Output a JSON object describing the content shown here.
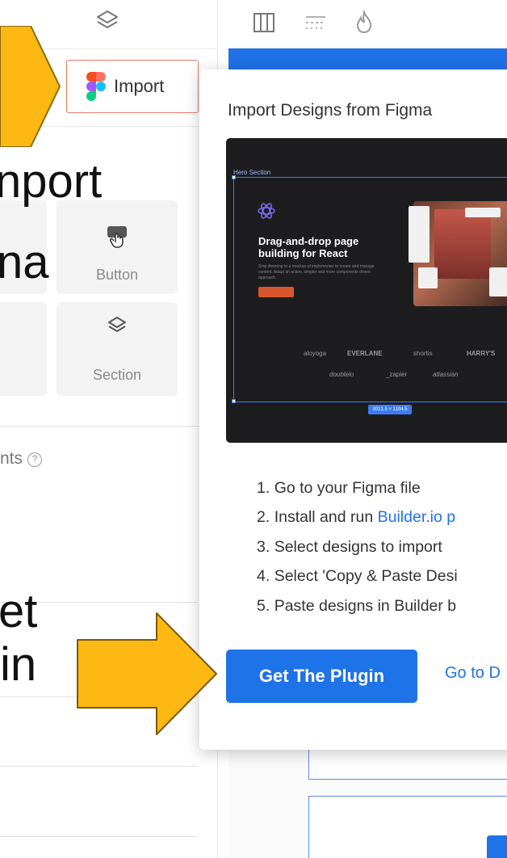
{
  "left_panel": {
    "import_label": "Import",
    "tiles": [
      {
        "label": "Button",
        "icon": "pointer-hand-icon"
      },
      {
        "label": "Section",
        "icon": "layers-icon"
      }
    ],
    "hint_text": "nts",
    "big_text_lines": [
      "nport",
      "na",
      "et",
      "in"
    ]
  },
  "popup": {
    "title": "Import Designs from Figma",
    "preview": {
      "section_tag": "Hero Section",
      "hero_title": "Drag-and-drop page building for React",
      "hero_sub": "Stop diverting to a mockup of implementer to create and manage content. Adapt an action, simpler and more components driven approach.",
      "brands": [
        "aloyoga",
        "EVERLANE",
        "shortis",
        "HARRY'S",
        "doubleio",
        "_zapier",
        "atlassian"
      ],
      "size_tag": "3021.5 × 1104.5"
    },
    "steps": [
      {
        "num": "1.",
        "text": "Go to your Figma file"
      },
      {
        "num": "2.",
        "text": "Install and run ",
        "link": "Builder.io p"
      },
      {
        "num": "3.",
        "text": "Select designs to import"
      },
      {
        "num": "4.",
        "text": "Select 'Copy & Paste Desi"
      },
      {
        "num": "5.",
        "text": "Paste designs in Builder b"
      }
    ],
    "primary_button": "Get The Plugin",
    "secondary_link": "Go to D"
  },
  "colors": {
    "accent": "#1f73e8",
    "arrow": "#fdb813"
  }
}
